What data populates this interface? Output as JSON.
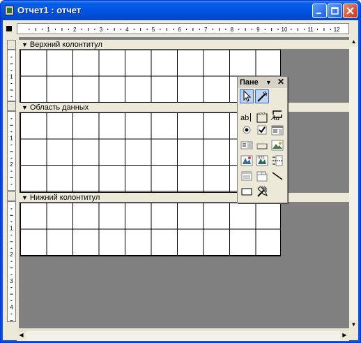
{
  "window": {
    "title": "Отчет1 : отчет"
  },
  "ruler": {
    "numbers": [
      "1",
      "2",
      "3",
      "4",
      "5",
      "6",
      "7",
      "8",
      "9",
      "10",
      "11",
      "12"
    ]
  },
  "vruler": {
    "header_numbers": [
      "1"
    ],
    "data_numbers": [
      "1",
      "2"
    ],
    "footer_numbers": [
      "1",
      "2",
      "3",
      "4"
    ]
  },
  "sections": {
    "header": "Верхний колонтитул",
    "detail": "Область данных",
    "footer": "Нижний колонтитул"
  },
  "toolbox": {
    "title": "Пане",
    "tools": [
      "select-objects",
      "control-wizards",
      "label",
      "text-box",
      "option-group",
      "toggle-button",
      "option-button",
      "check-box",
      "combo-box",
      "list-box",
      "command-button",
      "image",
      "unbound-object-frame",
      "bound-object-frame",
      "page-break",
      "subform",
      "tab-control",
      "line",
      "rectangle",
      "more-controls"
    ]
  }
}
